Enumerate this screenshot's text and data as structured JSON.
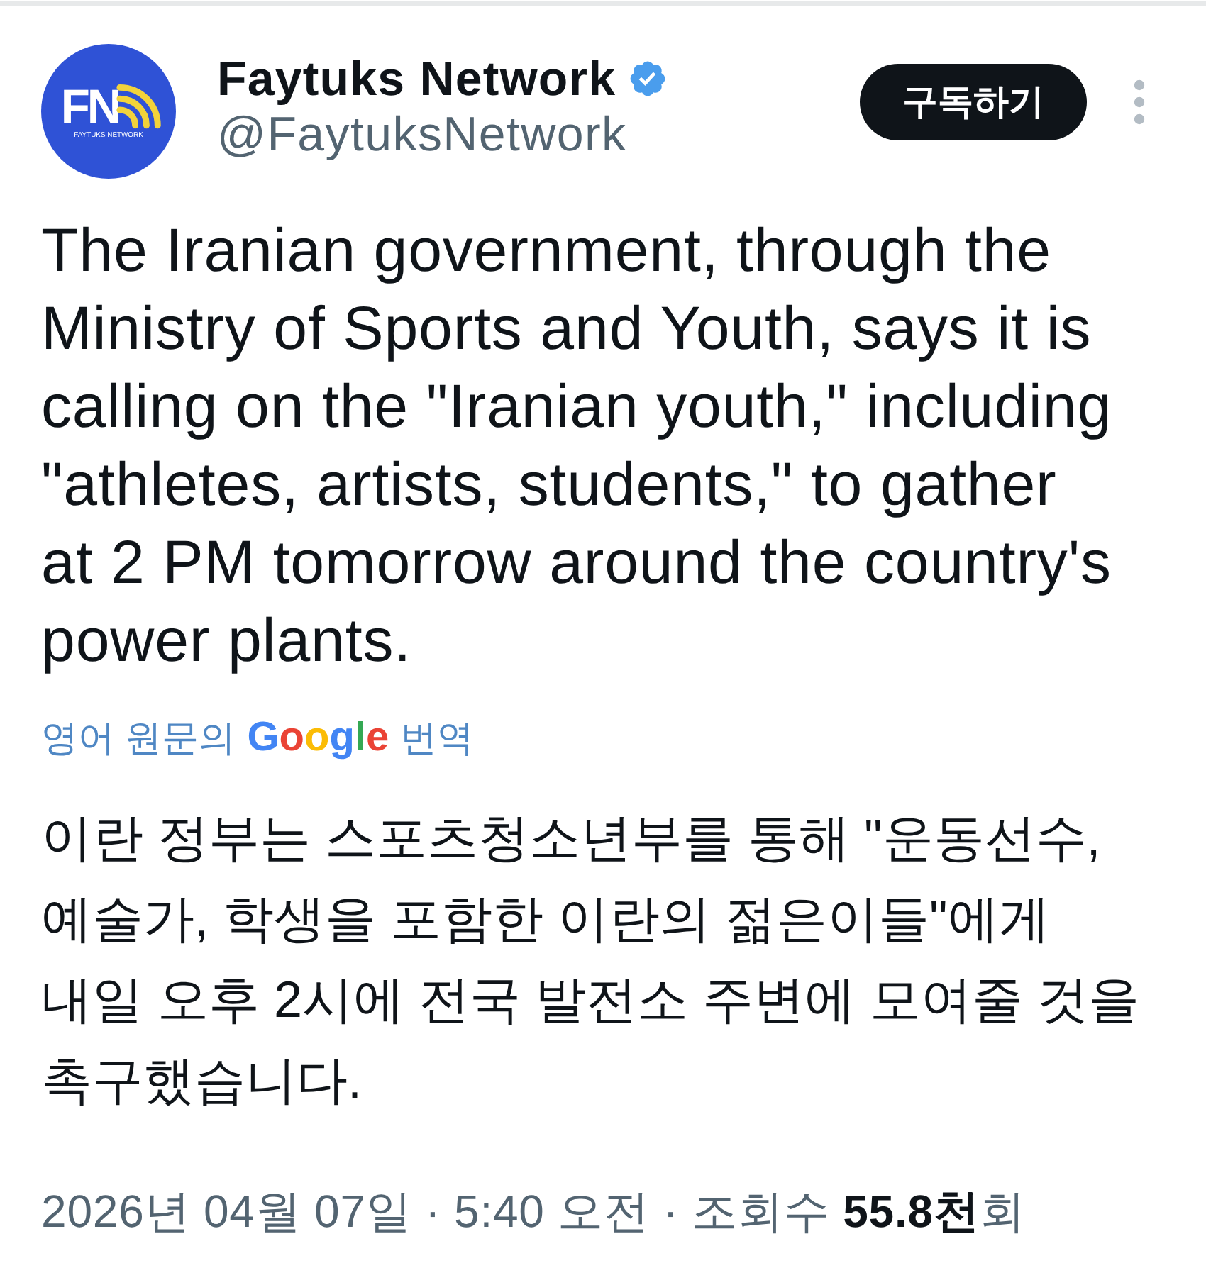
{
  "account": {
    "avatar": {
      "initials": "FN",
      "caption": "FAYTUKS NETWORK"
    },
    "name": "Faytuks Network",
    "verified": true,
    "handle": "@FaytuksNetwork"
  },
  "subscribe_button": {
    "label": "구독하기"
  },
  "post": {
    "text": "The Iranian government, through the Ministry of Sports and Youth, says it is calling on the \"Iranian youth,\" including \"athletes, artists, students,\" to gather at 2 PM tomorrow around the country's power plants.",
    "translation_note": {
      "prefix": "영어 원문의",
      "logo": "Google",
      "suffix": "번역"
    },
    "translated_text": "이란 정부는 스포츠청소년부를 통해 \"운동선수, 예술가, 학생을 포함한 이란의 젊은이들\"에게 내일 오후 2시에 전국 발전소 주변에 모여줄 것을 촉구했습니다.",
    "meta": "2026년 04월 07일 · 5:40 오전 · 조회수 **55.8천**회"
  }
}
